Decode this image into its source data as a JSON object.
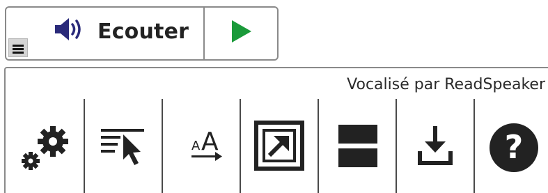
{
  "player": {
    "listen_label": "Ecouter",
    "menu_icon": "hamburger-menu-icon",
    "speaker_icon": "speaker-icon",
    "play_icon": "play-icon",
    "play_color": "#1a9a3a"
  },
  "toolbar": {
    "credit": "Vocalisé par ReadSpeaker",
    "tools": [
      {
        "icon": "settings-gears-icon"
      },
      {
        "icon": "click-and-listen-icon"
      },
      {
        "icon": "text-enlarge-icon"
      },
      {
        "icon": "popup-external-icon"
      },
      {
        "icon": "page-mask-icon"
      },
      {
        "icon": "download-icon"
      },
      {
        "icon": "help-icon"
      }
    ]
  },
  "colors": {
    "border": "#8a8a8a",
    "icon": "#222222",
    "play": "#1a9a3a",
    "menu_bg": "#d4d4d4"
  }
}
